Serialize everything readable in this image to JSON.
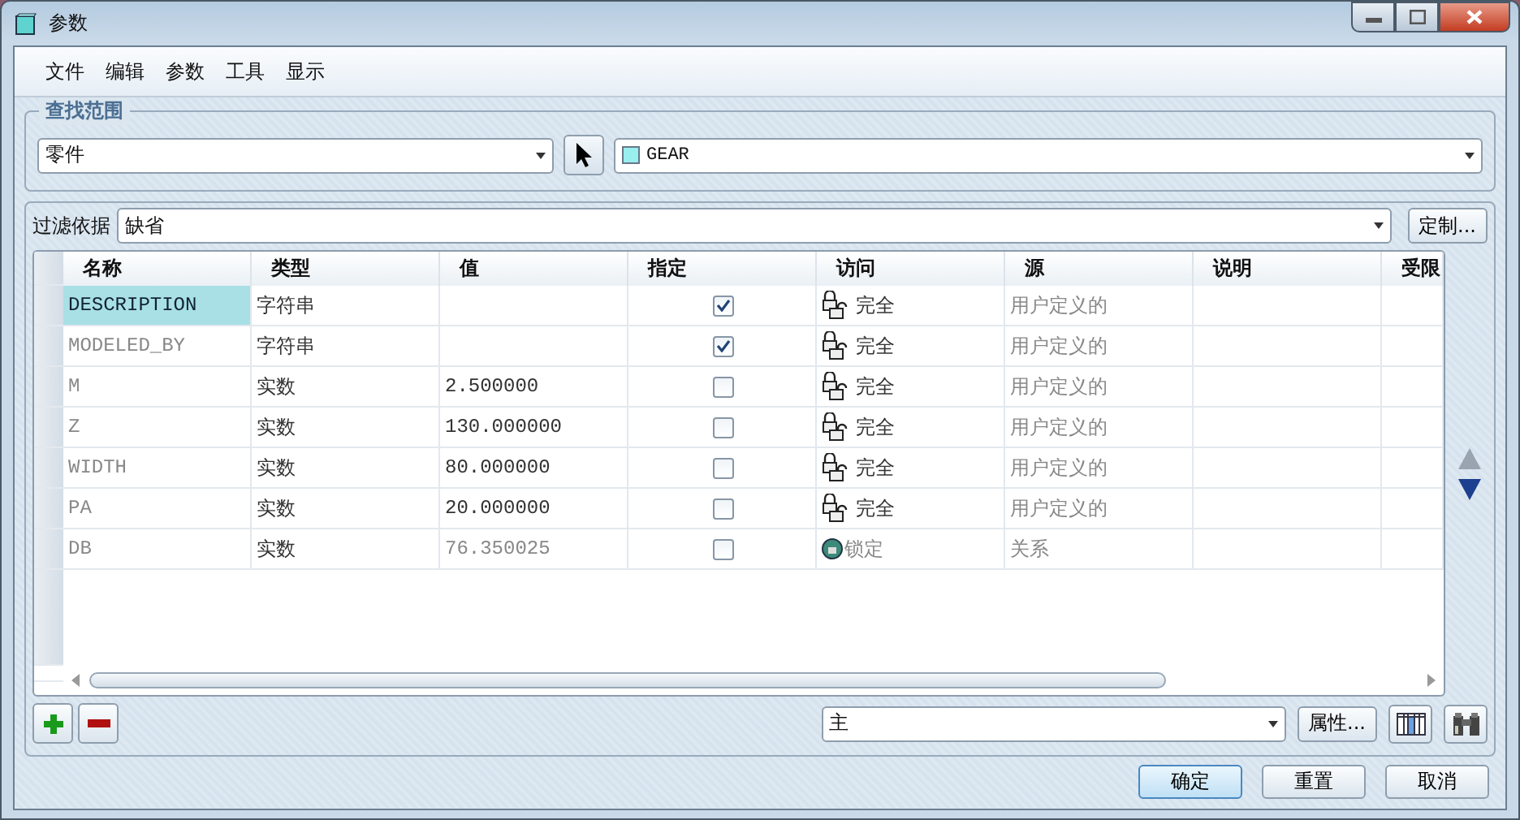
{
  "window": {
    "title": "参数"
  },
  "menu": [
    "文件",
    "编辑",
    "参数",
    "工具",
    "显示"
  ],
  "lookup": {
    "legend": "查找范围",
    "scope": "零件",
    "model": "GEAR"
  },
  "filter": {
    "label": "过滤依据",
    "value": "缺省",
    "button": "定制..."
  },
  "table": {
    "columns": [
      "名称",
      "类型",
      "值",
      "指定",
      "访问",
      "源",
      "说明",
      "受限"
    ],
    "rows": [
      {
        "name": "DESCRIPTION",
        "type": "字符串",
        "value": "",
        "designated": true,
        "access": {
          "kind": "full",
          "text": "完全"
        },
        "source": "用户定义的",
        "selected": true
      },
      {
        "name": "MODELED_BY",
        "type": "字符串",
        "value": "",
        "designated": true,
        "access": {
          "kind": "full",
          "text": "完全"
        },
        "source": "用户定义的",
        "selected": false
      },
      {
        "name": "M",
        "type": "实数",
        "value": "2.500000",
        "designated": false,
        "access": {
          "kind": "full",
          "text": "完全"
        },
        "source": "用户定义的",
        "selected": false
      },
      {
        "name": "Z",
        "type": "实数",
        "value": "130.000000",
        "designated": false,
        "access": {
          "kind": "full",
          "text": "完全"
        },
        "source": "用户定义的",
        "selected": false
      },
      {
        "name": "WIDTH",
        "type": "实数",
        "value": "80.000000",
        "designated": false,
        "access": {
          "kind": "full",
          "text": "完全"
        },
        "source": "用户定义的",
        "selected": false
      },
      {
        "name": "PA",
        "type": "实数",
        "value": "20.000000",
        "designated": false,
        "access": {
          "kind": "full",
          "text": "完全"
        },
        "source": "用户定义的",
        "selected": false
      },
      {
        "name": "DB",
        "type": "实数",
        "value": "76.350025",
        "designated": false,
        "access": {
          "kind": "locked",
          "text": "锁定"
        },
        "source": "关系",
        "selected": false
      }
    ]
  },
  "bottom": {
    "set": "主",
    "properties_button": "属性..."
  },
  "buttons": [
    "确定",
    "重置",
    "取消"
  ]
}
